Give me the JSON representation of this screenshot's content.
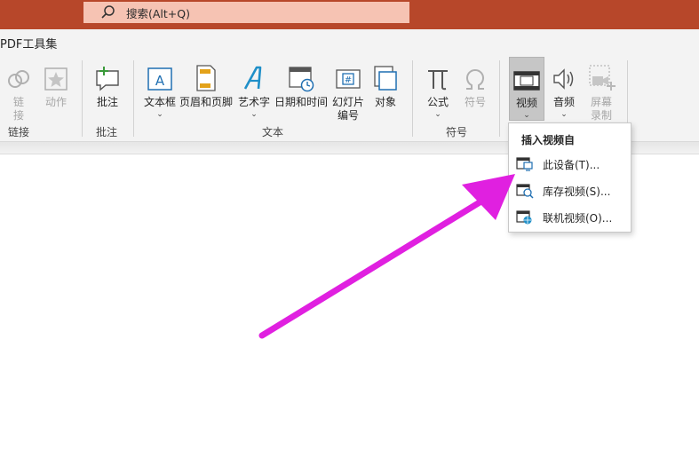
{
  "search": {
    "text": "搜索(Alt+Q)"
  },
  "tab": {
    "label": "PDF工具集"
  },
  "ribbon": {
    "links": {
      "link": "链接",
      "action": "动作",
      "group": "链接"
    },
    "comments": {
      "comment": "批注",
      "group": "批注"
    },
    "text": {
      "textbox": "文本框",
      "header_footer": "页眉和页脚",
      "wordart": "艺术字",
      "date_time": "日期和时间",
      "slide_number": "幻灯片编号",
      "object": "对象",
      "group": "文本"
    },
    "symbols": {
      "equation": "公式",
      "symbol": "符号",
      "group": "符号"
    },
    "media": {
      "video": "视频",
      "audio": "音频",
      "screen_recording": "屏幕录制"
    }
  },
  "dropdown": {
    "header": "插入视频自",
    "items": [
      {
        "label": "此设备(T)...",
        "icon": "device-video-icon"
      },
      {
        "label": "库存视频(S)...",
        "icon": "stock-video-icon"
      },
      {
        "label": "联机视频(O)...",
        "icon": "online-video-icon"
      }
    ]
  },
  "colors": {
    "titlebar": "#b7472a",
    "search_bg": "#f6c3b3",
    "arrow": "#e020e0",
    "ribbon_bg": "#f3f3f3"
  }
}
